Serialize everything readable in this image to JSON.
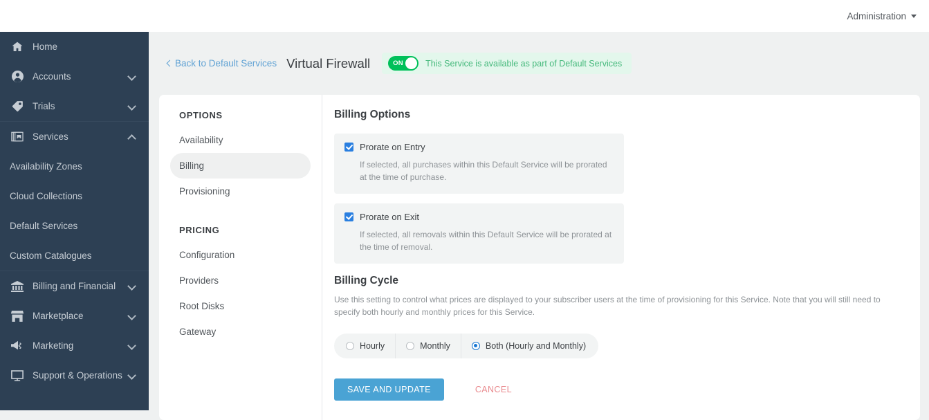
{
  "topbar": {
    "admin_label": "Administration",
    "caret_icon": "chevron-down-icon"
  },
  "sidebar": {
    "background": "#2d4054",
    "items": [
      {
        "label": "Home",
        "icon": "home-icon",
        "expandable": false
      },
      {
        "label": "Accounts",
        "icon": "user-circle-icon",
        "expandable": true,
        "expanded": false
      },
      {
        "label": "Trials",
        "icon": "tag-icon",
        "expandable": true,
        "expanded": false
      },
      {
        "label": "Services",
        "icon": "layers-icon",
        "expandable": true,
        "expanded": true
      }
    ],
    "services_children": [
      {
        "label": "Availability Zones"
      },
      {
        "label": "Cloud Collections"
      },
      {
        "label": "Default Services"
      },
      {
        "label": "Custom Catalogues"
      }
    ],
    "items_bottom": [
      {
        "label": "Billing and Financial",
        "icon": "bank-icon",
        "expandable": true,
        "expanded": false
      },
      {
        "label": "Marketplace",
        "icon": "store-icon",
        "expandable": true,
        "expanded": false
      },
      {
        "label": "Marketing",
        "icon": "megaphone-icon",
        "expandable": true,
        "expanded": false
      },
      {
        "label": "Support & Operations",
        "icon": "monitor-icon",
        "expandable": true,
        "expanded": false
      }
    ]
  },
  "header": {
    "back_label": "Back to Default Services",
    "back_icon": "chevron-left-icon",
    "title": "Virtual Firewall",
    "toggle_state": "ON",
    "toggle_color": "#00c05a",
    "status_text": "This Service is available as part of Default Services",
    "status_text_color": "#46b97c",
    "status_bg": "#e3f7ec"
  },
  "options_panel": {
    "sections": [
      {
        "title": "OPTIONS",
        "items": [
          {
            "label": "Availability",
            "active": false
          },
          {
            "label": "Billing",
            "active": true
          },
          {
            "label": "Provisioning",
            "active": false
          }
        ]
      },
      {
        "title": "PRICING",
        "items": [
          {
            "label": "Configuration",
            "active": false
          },
          {
            "label": "Providers",
            "active": false
          },
          {
            "label": "Root Disks",
            "active": false
          },
          {
            "label": "Gateway",
            "active": false
          }
        ]
      }
    ]
  },
  "billing": {
    "heading": "Billing Options",
    "options": [
      {
        "label": "Prorate on Entry",
        "checked": true,
        "description": "If selected, all purchases within this Default Service will be prorated at the time of purchase."
      },
      {
        "label": "Prorate on Exit",
        "checked": true,
        "description": "If selected, all removals within this Default Service will be prorated at the time of removal."
      }
    ],
    "cycle_heading": "Billing Cycle",
    "cycle_description": "Use this setting to control what prices are displayed to your subscriber users at the time of provisioning for this Service. Note that you will still need to specify both hourly and monthly prices for this Service.",
    "cycle_options": [
      {
        "label": "Hourly",
        "selected": false
      },
      {
        "label": "Monthly",
        "selected": false
      },
      {
        "label": "Both (Hourly and Monthly)",
        "selected": true
      }
    ],
    "save_label": "SAVE AND UPDATE",
    "cancel_label": "CANCEL",
    "save_color": "#4aa3d4",
    "cancel_color": "#e98a8e",
    "checkbox_color": "#2a7fe0",
    "radio_color": "#1877d2"
  }
}
